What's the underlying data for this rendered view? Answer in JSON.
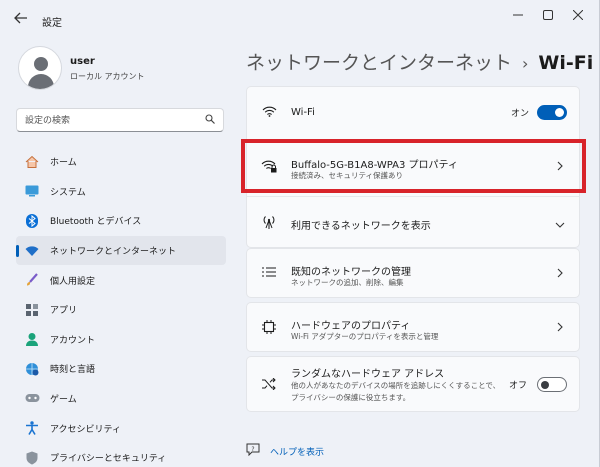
{
  "window": {
    "title": "設定",
    "back_icon": "arrow-left-icon",
    "controls": [
      "minimize",
      "maximize",
      "close"
    ]
  },
  "user": {
    "name": "user",
    "account_type": "ローカル アカウント"
  },
  "search": {
    "placeholder": "設定の検索"
  },
  "sidebar": {
    "items": [
      {
        "label": "ホーム",
        "icon": "home-icon",
        "active": false
      },
      {
        "label": "システム",
        "icon": "system-icon",
        "active": false
      },
      {
        "label": "Bluetooth とデバイス",
        "icon": "bluetooth-icon",
        "active": false
      },
      {
        "label": "ネットワークとインターネット",
        "icon": "network-icon",
        "active": true
      },
      {
        "label": "個人用設定",
        "icon": "brush-icon",
        "active": false
      },
      {
        "label": "アプリ",
        "icon": "apps-icon",
        "active": false
      },
      {
        "label": "アカウント",
        "icon": "account-icon",
        "active": false
      },
      {
        "label": "時刻と言語",
        "icon": "globe-icon",
        "active": false
      },
      {
        "label": "ゲーム",
        "icon": "gamepad-icon",
        "active": false
      },
      {
        "label": "アクセシビリティ",
        "icon": "accessibility-icon",
        "active": false
      },
      {
        "label": "プライバシーとセキュリティ",
        "icon": "shield-icon",
        "active": false
      }
    ]
  },
  "breadcrumb": {
    "parent": "ネットワークとインターネット",
    "separator": "›",
    "current": "Wi-Fi"
  },
  "wifi_card": {
    "toggle_row": {
      "title": "Wi-Fi",
      "state_label": "オン",
      "toggle_on": true
    },
    "network_row": {
      "title": "Buffalo-5G-B1A8-WPA3 プロパティ",
      "subtitle": "接続済み、セキュリティ保護あり"
    },
    "available_row": {
      "title": "利用できるネットワークを表示"
    }
  },
  "known_networks": {
    "title": "既知のネットワークの管理",
    "subtitle": "ネットワークの追加、削除、編集"
  },
  "hardware": {
    "title": "ハードウェアのプロパティ",
    "subtitle": "Wi-Fi アダプターのプロパティを表示と管理"
  },
  "random_hw": {
    "title": "ランダムなハードウェア アドレス",
    "subtitle_line1": "他の人があなたのデバイスの場所を追跡しにくくすることで、",
    "subtitle_line2": "プライバシーの保護に役立ちます。",
    "state_label": "オフ",
    "toggle_on": false
  },
  "help": {
    "label": "ヘルプを表示"
  },
  "colors": {
    "accent": "#005fb8",
    "highlight_box": "#d8232a"
  }
}
